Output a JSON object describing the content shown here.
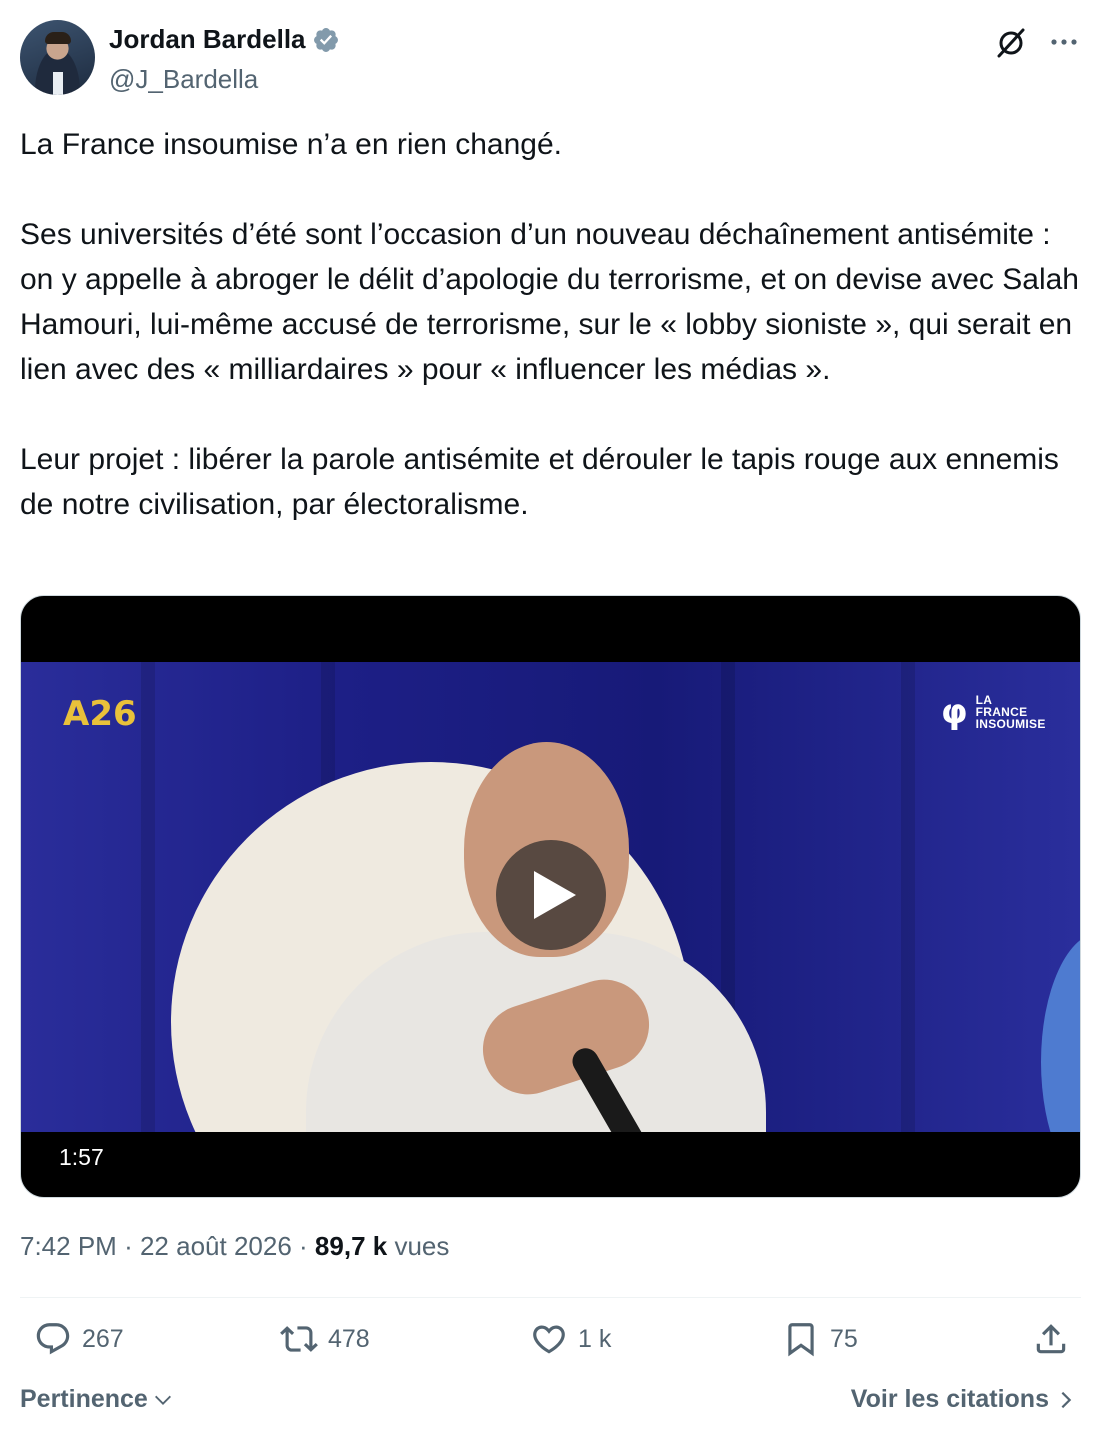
{
  "author": {
    "name": "Jordan Bardella",
    "handle": "@J_Bardella",
    "verified": true
  },
  "tweet": {
    "paragraphs": [
      "La France insoumise n’a en rien changé.",
      "Ses universités d’été sont l’occasion d’un nouveau déchaînement antisémite : on y appelle à abroger le délit d’apologie du terrorisme, et on devise avec Salah Hamouri, lui-même accusé de terrorisme, sur le « lobby sioniste », qui serait en lien avec des « milliardaires » pour « influencer les médias ».",
      "Leur projet : libérer la parole antisémite et dérouler le tapis rouge aux ennemis de notre civilisation, par électoralisme."
    ]
  },
  "video": {
    "duration": "1:57",
    "logo_left": "A26",
    "logo_right_symbol": "φ",
    "logo_right_text": [
      "LA",
      "FRANCE",
      "INSOUMISE"
    ]
  },
  "meta": {
    "time": "7:42 PM",
    "separator": "·",
    "date": "22 août 2026",
    "views_count": "89,7 k",
    "views_label": "vues"
  },
  "actions": {
    "replies": "267",
    "reposts": "478",
    "likes": "1 k",
    "bookmarks": "75"
  },
  "footer": {
    "sort_label": "Pertinence",
    "quotes_label": "Voir les citations"
  },
  "colors": {
    "verified": "#829aab",
    "secondary_text": "#536471",
    "primary_text": "#0f1419"
  }
}
